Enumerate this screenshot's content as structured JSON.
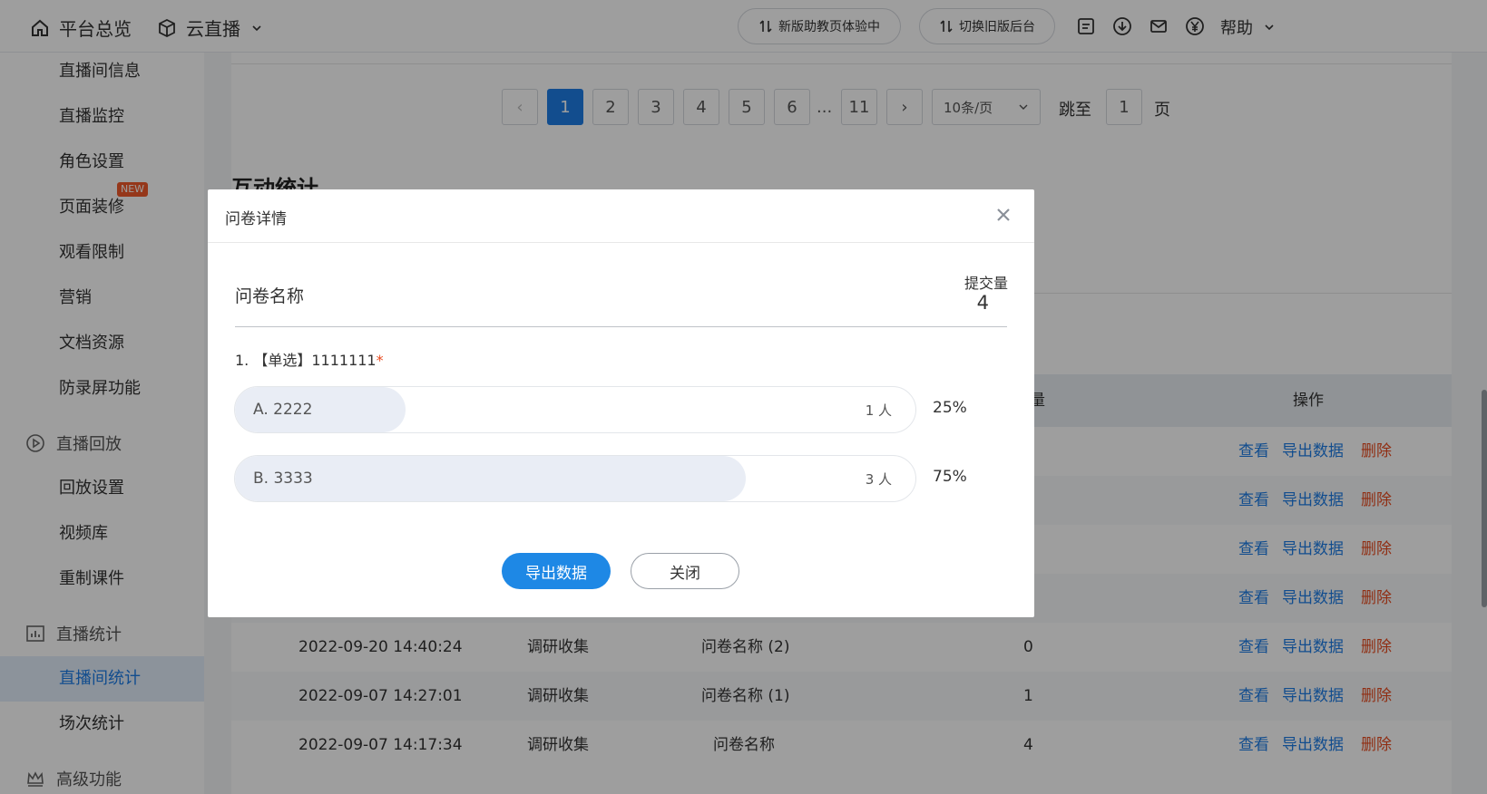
{
  "topbar": {
    "home_label": "平台总览",
    "live_label": "云直播",
    "new_assist_label": "新版助教页体验中",
    "switch_label": "切换旧版后台",
    "help_label": "帮助"
  },
  "sidebar": {
    "items": [
      "直播间信息",
      "直播监控",
      "角色设置",
      "页面装修",
      "观看限制",
      "营销",
      "文档资源",
      "防录屏功能"
    ],
    "new_badge": "NEW",
    "replay_group": "直播回放",
    "replay_items": [
      "回放设置",
      "视频库",
      "重制课件"
    ],
    "stats_group": "直播统计",
    "stats_items": [
      "直播间统计",
      "场次统计"
    ],
    "advanced_group": "高级功能"
  },
  "pager": {
    "prev": "‹",
    "pages": [
      "1",
      "2",
      "3",
      "4",
      "5",
      "6"
    ],
    "ellipsis": "...",
    "last": "11",
    "next": "›",
    "page_size": "10条/页",
    "jump_label": "跳至",
    "jump_value": "1",
    "page_suffix": "页"
  },
  "section": {
    "title": "互动统计"
  },
  "table": {
    "col_count_partial": "量",
    "col_ops": "操作",
    "ops": {
      "view": "查看",
      "export": "导出数据",
      "delete": "删除"
    },
    "rows": [
      {
        "time": "2022-09-20 14:40:24",
        "type": "调研收集",
        "name": "问卷名称 (2)",
        "count": "0"
      },
      {
        "time": "2022-09-07 14:27:01",
        "type": "调研收集",
        "name": "问卷名称 (1)",
        "count": "1"
      },
      {
        "time": "2022-09-07 14:17:34",
        "type": "调研收集",
        "name": "问卷名称",
        "count": "4"
      }
    ]
  },
  "modal": {
    "title": "问卷详情",
    "survey_name": "问卷名称",
    "submit_label": "提交量",
    "submit_value": "4",
    "question": {
      "text": "1. 【单选】1111111",
      "required_mark": "*"
    },
    "options": [
      {
        "label": "A. 2222",
        "count": "1 人",
        "percent": "25%",
        "ratio": 0.25
      },
      {
        "label": "B. 3333",
        "count": "3 人",
        "percent": "75%",
        "ratio": 0.75
      }
    ],
    "export_button": "导出数据",
    "close_button": "关闭"
  }
}
